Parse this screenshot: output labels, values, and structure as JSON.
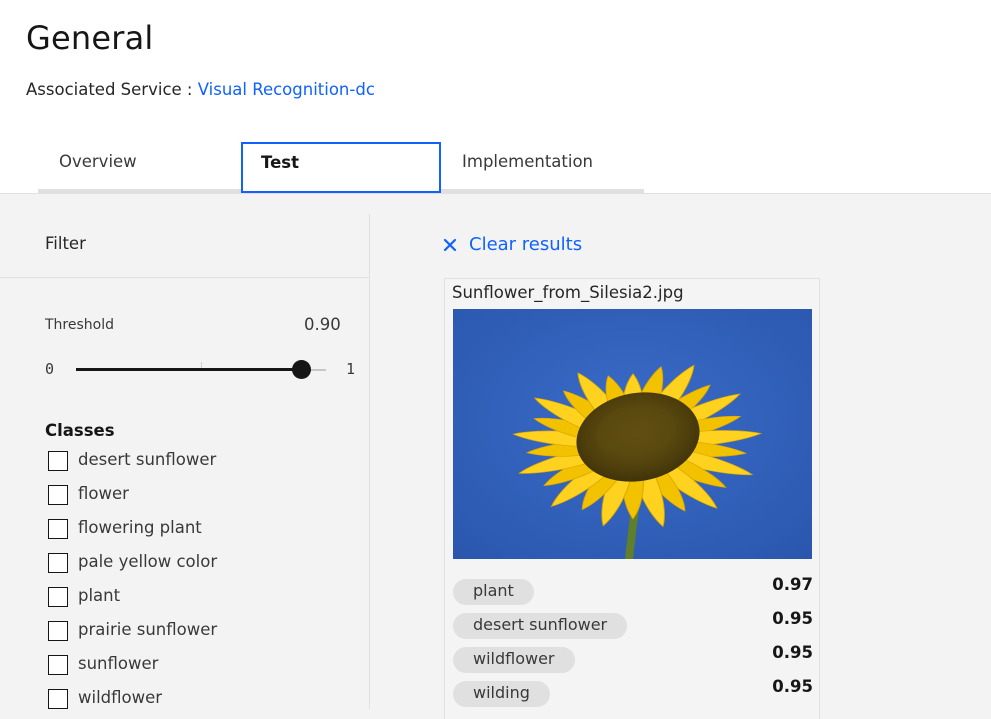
{
  "header": {
    "title": "General",
    "associated_service_label": "Associated Service : ",
    "associated_service_link": "Visual Recognition-dc"
  },
  "tabs": [
    {
      "label": "Overview",
      "selected": false
    },
    {
      "label": "Test",
      "selected": true
    },
    {
      "label": "Implementation",
      "selected": false
    }
  ],
  "filter": {
    "title": "Filter",
    "threshold_label": "Threshold",
    "threshold_value": "0.90",
    "slider_min": "0",
    "slider_max": "1",
    "slider_level": 0.9,
    "classes_title": "Classes",
    "classes": [
      {
        "label": "desert sunflower",
        "checked": false
      },
      {
        "label": "flower",
        "checked": false
      },
      {
        "label": "flowering plant",
        "checked": false
      },
      {
        "label": "pale yellow color",
        "checked": false
      },
      {
        "label": "plant",
        "checked": false
      },
      {
        "label": "prairie sunflower",
        "checked": false
      },
      {
        "label": "sunflower",
        "checked": false
      },
      {
        "label": "wildflower",
        "checked": false
      }
    ]
  },
  "results": {
    "clear_label": "Clear results",
    "filename": "Sunflower_from_Silesia2.jpg",
    "items": [
      {
        "tag": "plant",
        "score": "0.97"
      },
      {
        "tag": "desert sunflower",
        "score": "0.95"
      },
      {
        "tag": "wildflower",
        "score": "0.95"
      },
      {
        "tag": "wilding",
        "score": "0.95"
      }
    ]
  },
  "colors": {
    "accent": "#0f62fe",
    "sky": "#2f5fb9",
    "petal": "#f6c800",
    "seed_center": "#5b4a10"
  }
}
